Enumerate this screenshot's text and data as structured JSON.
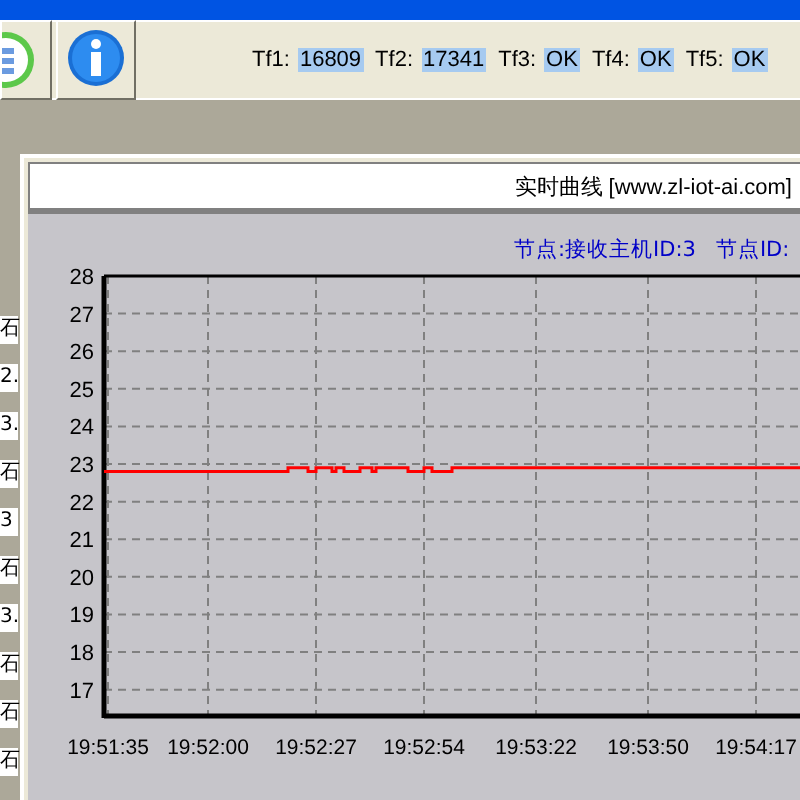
{
  "toolbar": {
    "buttons": [
      {
        "kind": "list"
      },
      {
        "kind": "info"
      }
    ],
    "status": [
      {
        "label": "Tf1:",
        "value": "16809"
      },
      {
        "label": "Tf2:",
        "value": "17341"
      },
      {
        "label": "Tf3:",
        "value": "OK"
      },
      {
        "label": "Tf4:",
        "value": "OK"
      },
      {
        "label": "Tf5:",
        "value": "OK"
      }
    ]
  },
  "side_cells": [
    "石",
    "2.",
    "3.",
    "石",
    "3",
    "石",
    "3.",
    "石",
    "石",
    "石"
  ],
  "window": {
    "title": "实时曲线 [www.zl-iot-ai.com]",
    "legend": [
      "节点:接收主机ID:3",
      "节点ID:"
    ],
    "chart_data": {
      "type": "line",
      "grid": true,
      "xlim": [
        71494,
        71668
      ],
      "ylim": [
        16.3,
        28
      ],
      "yticks": [
        17,
        18,
        19,
        20,
        21,
        22,
        23,
        24,
        25,
        26,
        27,
        28
      ],
      "xticks": [
        {
          "value": 71495,
          "label": "19:51:35"
        },
        {
          "value": 71520,
          "label": "19:52:00"
        },
        {
          "value": 71547,
          "label": "19:52:27"
        },
        {
          "value": 71574,
          "label": "19:52:54"
        },
        {
          "value": 71602,
          "label": "19:53:22"
        },
        {
          "value": 71630,
          "label": "19:53:50"
        },
        {
          "value": 71657,
          "label": "19:54:17"
        }
      ],
      "x": [
        71494,
        71540,
        71540,
        71545,
        71545,
        71547,
        71547,
        71551,
        71551,
        71552,
        71552,
        71554,
        71554,
        71558,
        71558,
        71561,
        71561,
        71562,
        71562,
        71570,
        71570,
        71574,
        71574,
        71576,
        71576,
        71581,
        71581,
        71668
      ],
      "series": [
        {
          "color": "#ff0000",
          "values": [
            22.8,
            22.8,
            22.9,
            22.9,
            22.8,
            22.8,
            22.9,
            22.9,
            22.8,
            22.8,
            22.9,
            22.9,
            22.8,
            22.8,
            22.9,
            22.9,
            22.8,
            22.8,
            22.9,
            22.9,
            22.8,
            22.8,
            22.9,
            22.9,
            22.8,
            22.8,
            22.9,
            22.9
          ]
        }
      ]
    }
  }
}
